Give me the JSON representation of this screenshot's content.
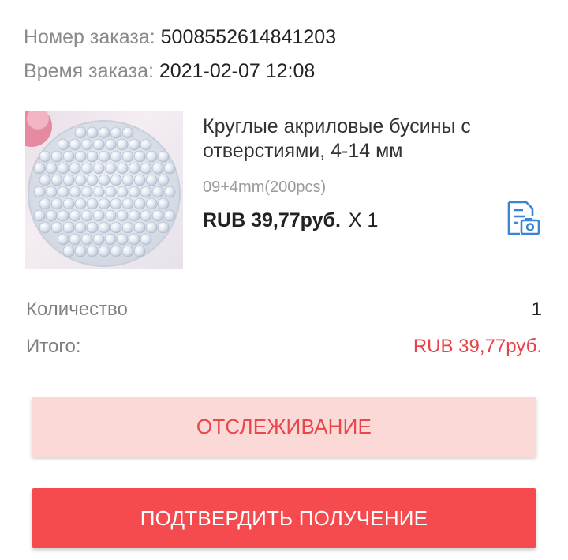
{
  "order": {
    "number_label": "Номер заказа:",
    "number_value": "5008552614841203",
    "time_label": "Время заказа:",
    "time_value": "2021-02-07 12:08"
  },
  "product": {
    "title": "Круглые акриловые бусины с отверстиями, 4-14 мм",
    "variant": "09+4mm(200pcs)",
    "price": "RUB 39,77руб.",
    "quantity": "X 1",
    "image_icon": "beads-product-photo",
    "action_icon": "document-camera-icon"
  },
  "summary": {
    "quantity_label": "Количество",
    "quantity_value": "1",
    "total_label": "Итого:",
    "total_value": "RUB 39,77руб."
  },
  "buttons": {
    "track_label": "ОТСЛЕЖИВАНИЕ",
    "confirm_label": "ПОДТВЕРДИТЬ ПОЛУЧЕНИЕ"
  },
  "colors": {
    "accent_red": "#f54a4e",
    "total_red": "#e8434a",
    "track_bg": "#fbd9d6",
    "icon_blue": "#3a86d6"
  }
}
